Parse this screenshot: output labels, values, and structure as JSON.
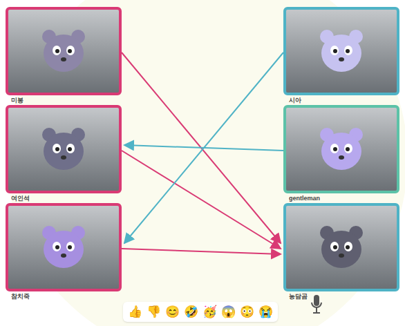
{
  "participants": {
    "left": [
      {
        "name": "미봉",
        "color": "#d93a74"
      },
      {
        "name": "여인석",
        "color": "#d93a74"
      },
      {
        "name": "참치죽",
        "color": "#d93a74"
      }
    ],
    "right": [
      {
        "name": "시아",
        "color": "#4fb3c6"
      },
      {
        "name": "gentleman",
        "color": "#5cc2a8"
      },
      {
        "name": "농담곰",
        "color": "#4fb3c6"
      }
    ]
  },
  "arrows": [
    {
      "from": "미봉",
      "to": "농담곰",
      "color": "#d93a74"
    },
    {
      "from": "여인석",
      "to": "농담곰",
      "color": "#d93a74"
    },
    {
      "from": "참치죽",
      "to": "농담곰",
      "color": "#d93a74"
    },
    {
      "from": "시아",
      "to": "참치죽",
      "color": "#4fb3c6"
    },
    {
      "from": "gentleman",
      "to": "여인석",
      "color": "#4fb3c6"
    }
  ],
  "reactions": [
    "👍",
    "👎",
    "😊",
    "🤣",
    "🥳",
    "😱",
    "😳",
    "😭"
  ]
}
